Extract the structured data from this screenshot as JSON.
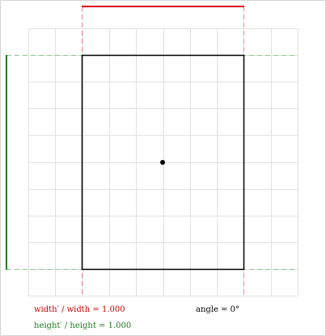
{
  "readouts": {
    "width_ratio": "width′ / width = 1.000",
    "height_ratio": "height′ / height = 1.000",
    "angle": "angle = 0°"
  },
  "colors": {
    "width_guide": "#d40000",
    "height_guide": "#1f7a1f",
    "height_guide_dashed": "#8fc48f",
    "width_guide_dashed": "#f08a8a",
    "grid": "#e2e2e2",
    "rectangle": "#000000",
    "center_point": "#000000"
  },
  "grid": {
    "columns": 10,
    "rows": 10
  }
}
